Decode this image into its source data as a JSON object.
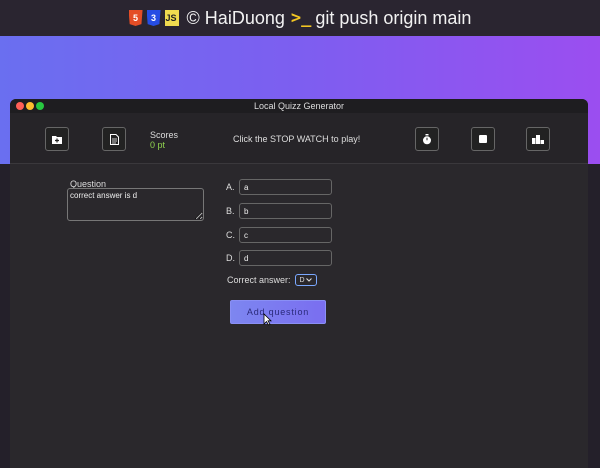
{
  "topbar": {
    "html_badge": "5",
    "css_badge": "3",
    "js_badge": "JS",
    "copyright": "© HaiDuong",
    "command": "git push origin main"
  },
  "window": {
    "title": "Local Quizz Generator",
    "dots": {
      "close": "#ff5f57",
      "minimize": "#ffbd2e",
      "maximize": "#28c840"
    }
  },
  "toolbar": {
    "icons": [
      "folder-add-icon",
      "document-icon",
      "stopwatch-icon",
      "stop-icon",
      "leaderboard-icon"
    ],
    "scores_label": "Scores",
    "scores_value": "0 pt",
    "play_prompt": "Click the STOP WATCH to play!"
  },
  "question": {
    "label": "Question",
    "text": "correct answer is d"
  },
  "options": [
    {
      "letter": "A.",
      "value": "a"
    },
    {
      "letter": "B.",
      "value": "b"
    },
    {
      "letter": "C.",
      "value": "c"
    },
    {
      "letter": "D.",
      "value": "d"
    }
  ],
  "correct_answer": {
    "label": "Correct answer:",
    "selected": "D"
  },
  "add_button": {
    "label": "Add question"
  },
  "colors": {
    "hero_gradient_start": "#6a6ff0",
    "hero_gradient_end": "#9b4ef0",
    "score_value": "#8fd14f",
    "accent": "#7a7ff0"
  }
}
